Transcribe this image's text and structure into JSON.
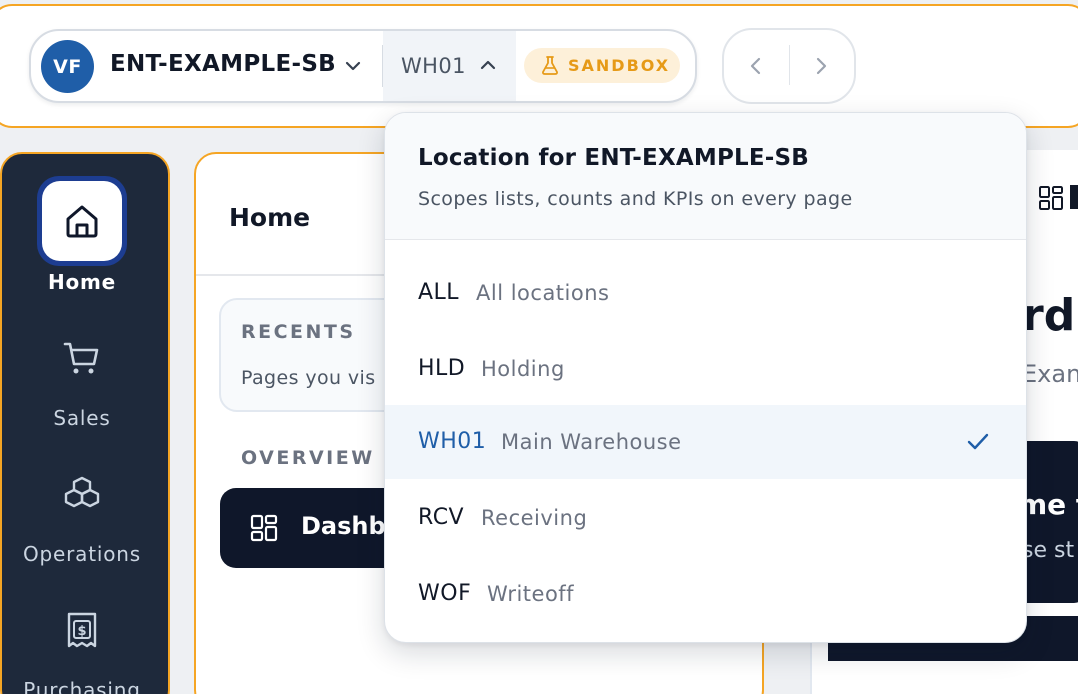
{
  "colors": {
    "accent_outline": "#f5a524",
    "brand_blue": "#1f5ea8",
    "rail_bg": "#1e293b",
    "dark": "#0f172a",
    "sandbox_text": "#e69a17",
    "sandbox_bg": "#fdf0d9"
  },
  "topbar": {
    "avatar_initials": "VF",
    "org_name": "ENT-EXAMPLE-SB",
    "org_chevron_icon": "chevron-down-icon",
    "location_current": "WH01",
    "location_chevron_icon": "chevron-up-icon",
    "sandbox_icon": "flask-icon",
    "sandbox_label": "SANDBOX",
    "back_icon": "chevron-left-icon",
    "forward_icon": "chevron-right-icon"
  },
  "rail": {
    "items": [
      {
        "label": "Home",
        "icon": "home-icon",
        "active": true
      },
      {
        "label": "Sales",
        "icon": "cart-icon",
        "active": false
      },
      {
        "label": "Operations",
        "icon": "boxes-icon",
        "active": false
      },
      {
        "label": "Purchasing",
        "icon": "receipt-icon",
        "active": false
      }
    ]
  },
  "panel": {
    "title": "Home",
    "recents_title": "RECENTS",
    "recents_sub": "Pages you vis",
    "overview_label": "OVERVIEW",
    "dashboard_label": "Dashb",
    "dashboard_icon": "grid-icon"
  },
  "right": {
    "heading_fragment": "rd",
    "sub_fragment": "Exan",
    "card_title_fragment": "me t",
    "card_sub_fragment": "se st",
    "grid_icon": "grid-icon"
  },
  "location_dropdown": {
    "title": "Location for ENT-EXAMPLE-SB",
    "subtitle": "Scopes lists, counts and KPIs on every page",
    "options": [
      {
        "code": "ALL",
        "name": "All locations",
        "selected": false
      },
      {
        "code": "HLD",
        "name": "Holding",
        "selected": false
      },
      {
        "code": "WH01",
        "name": "Main Warehouse",
        "selected": true
      },
      {
        "code": "RCV",
        "name": "Receiving",
        "selected": false
      },
      {
        "code": "WOF",
        "name": "Writeoff",
        "selected": false
      }
    ],
    "check_icon": "check-icon"
  }
}
